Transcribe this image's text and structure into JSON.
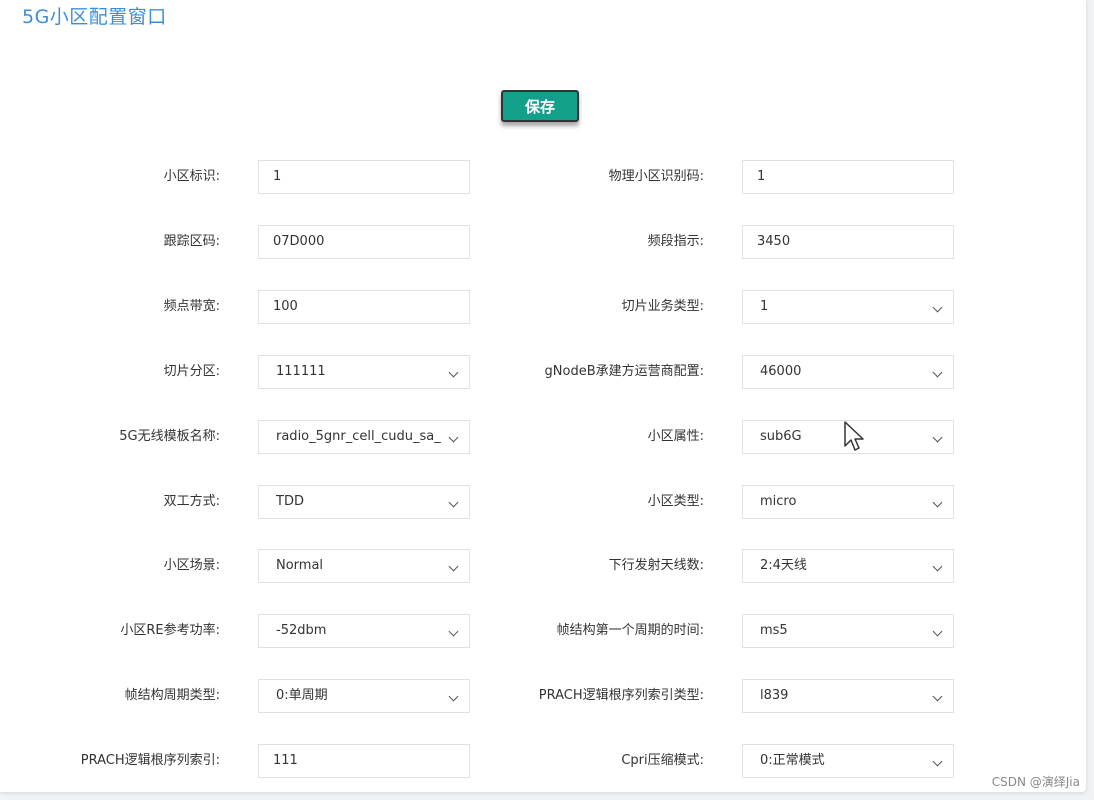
{
  "window": {
    "title": "5G小区配置窗口",
    "save_label": "保存"
  },
  "form": {
    "rows": [
      {
        "left": {
          "label": "小区标识:",
          "type": "input",
          "value": "1"
        },
        "right": {
          "label": "物理小区识别码:",
          "type": "input",
          "value": "1"
        }
      },
      {
        "left": {
          "label": "跟踪区码:",
          "type": "input",
          "value": "07D000"
        },
        "right": {
          "label": "频段指示:",
          "type": "input",
          "value": "3450"
        }
      },
      {
        "left": {
          "label": "频点带宽:",
          "type": "input",
          "value": "100"
        },
        "right": {
          "label": "切片业务类型:",
          "type": "select",
          "value": "1"
        }
      },
      {
        "left": {
          "label": "切片分区:",
          "type": "select",
          "value": "111111"
        },
        "right": {
          "label": "gNodeB承建方运营商配置:",
          "type": "select",
          "value": "46000"
        }
      },
      {
        "left": {
          "label": "5G无线模板名称:",
          "type": "select",
          "value": "radio_5gnr_cell_cudu_sa_"
        },
        "right": {
          "label": "小区属性:",
          "type": "select",
          "value": "sub6G"
        }
      },
      {
        "left": {
          "label": "双工方式:",
          "type": "select",
          "value": "TDD"
        },
        "right": {
          "label": "小区类型:",
          "type": "select",
          "value": "micro"
        }
      },
      {
        "left": {
          "label": "小区场景:",
          "type": "select",
          "value": "Normal"
        },
        "right": {
          "label": "下行发射天线数:",
          "type": "select",
          "value": "2:4天线"
        }
      },
      {
        "left": {
          "label": "小区RE参考功率:",
          "type": "select",
          "value": "-52dbm"
        },
        "right": {
          "label": "帧结构第一个周期的时间:",
          "type": "select",
          "value": "ms5"
        }
      },
      {
        "left": {
          "label": "帧结构周期类型:",
          "type": "select",
          "value": "0:单周期"
        },
        "right": {
          "label": "PRACH逻辑根序列索引类型:",
          "type": "select",
          "value": "l839"
        }
      },
      {
        "left": {
          "label": "PRACH逻辑根序列索引:",
          "type": "input",
          "value": "111"
        },
        "right": {
          "label": "Cpri压缩模式:",
          "type": "select",
          "value": "0:正常模式"
        }
      }
    ]
  },
  "watermark": "CSDN @演绎Jia",
  "icons": {
    "cursor": "mouse-pointer-icon",
    "chevron": "chevron-down-icon"
  },
  "colors": {
    "title": "#3b8fd9",
    "save_button": "#12a08b"
  }
}
